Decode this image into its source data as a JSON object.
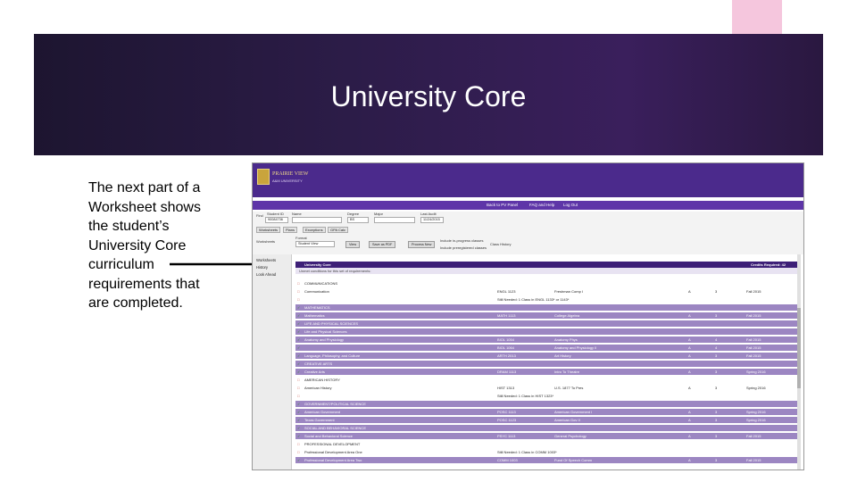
{
  "slide": {
    "title": "University Core",
    "body": "The next part of a Worksheet shows the student’s University Core curriculum requirements that are completed."
  },
  "colors": {
    "title_bg": "#2c1c48",
    "accent": "#f5c6dd",
    "header_purple": "#4b2a8c",
    "row_satisfied": "#9c86c2"
  },
  "screenshot": {
    "logo_name": "PRAIRIE VIEW",
    "logo_sub": "A&M UNIVERSITY",
    "nav": [
      "Back to PV Panel",
      "FAQ and Help",
      "Log Out"
    ],
    "form": {
      "student_id_label": "Student ID",
      "student_id_value": "90084736",
      "name_label": "Name",
      "degree_label": "Degree",
      "degree_value": "BS",
      "major_label": "Major",
      "last_audit_label": "Last Audit",
      "last_audit_value": "11/24/2015",
      "find_label": "Find",
      "format_label": "Format",
      "format_value": "Student View",
      "worksheets_label": "Worksheets",
      "tabs": [
        "Worksheets",
        "Plans",
        "Exceptions",
        "GPA Calc"
      ],
      "buttons": [
        "View",
        "Save as PDF",
        "Process New"
      ],
      "checkbox_1": "Include in-progress classes",
      "checkbox_2": "Include preregistered classes",
      "class_history": "Class History"
    },
    "sidebar": [
      "Worksheets",
      "History",
      "Look Ahead"
    ],
    "header_row": {
      "label": "University Core",
      "credits": "Credits Required: 42"
    },
    "note_row": "Unmet conditions for this set of requirements: ",
    "rows": [
      {
        "name": "COMMUNICATIONS",
        "status": "unsat",
        "course": "",
        "title": "",
        "grade": "",
        "credits": "",
        "term": ""
      },
      {
        "name": "Communication",
        "status": "unsat",
        "course": "ENGL 1123",
        "title": "Freshman Comp I",
        "grade": "A",
        "credits": "3",
        "term": "Fall 2015"
      },
      {
        "name": "",
        "status": "unsat",
        "course": "Still Needed: 1 Class in ENGL 1133* or 1143*",
        "title": "",
        "grade": "",
        "credits": "",
        "term": ""
      },
      {
        "name": "MATHEMATICS",
        "status": "sat",
        "course": "",
        "title": "",
        "grade": "",
        "credits": "",
        "term": ""
      },
      {
        "name": "Mathematics",
        "status": "sat",
        "course": "MATH 1113",
        "title": "College Algebra",
        "grade": "A",
        "credits": "3",
        "term": "Fall 2015"
      },
      {
        "name": "LIFE AND PHYSICAL SCIENCES",
        "status": "sat",
        "course": "",
        "title": "",
        "grade": "",
        "credits": "",
        "term": ""
      },
      {
        "name": "Life and Physical Sciences",
        "status": "sat",
        "course": "",
        "title": "",
        "grade": "",
        "credits": "",
        "term": ""
      },
      {
        "name": "Anatomy and Physiology",
        "status": "sat",
        "course": "BIOL 1054",
        "title": "Anatomy Phys",
        "grade": "A",
        "credits": "4",
        "term": "Fall 2015"
      },
      {
        "name": "",
        "status": "sat",
        "course": "BIOL 1064",
        "title": "Anatomy and Physiology II",
        "grade": "A",
        "credits": "4",
        "term": "Fall 2015"
      },
      {
        "name": "Language, Philosophy, and Culture",
        "status": "sat",
        "course": "ARTH 2013",
        "title": "Art History",
        "grade": "A",
        "credits": "3",
        "term": "Fall 2015"
      },
      {
        "name": "CREATIVE ARTS",
        "status": "sat",
        "course": "",
        "title": "",
        "grade": "",
        "credits": "",
        "term": ""
      },
      {
        "name": "Creative Arts",
        "status": "sat",
        "course": "DRAM 1113",
        "title": "Intro To Theatre",
        "grade": "A",
        "credits": "3",
        "term": "Spring 2016"
      },
      {
        "name": "AMERICAN HISTORY",
        "status": "unsat",
        "course": "",
        "title": "",
        "grade": "",
        "credits": "",
        "term": ""
      },
      {
        "name": "American History",
        "status": "unsat",
        "course": "HIST 1313",
        "title": "U.S. 1877 To Pres",
        "grade": "A",
        "credits": "3",
        "term": "Spring 2016"
      },
      {
        "name": "",
        "status": "unsat",
        "course": "Still Needed: 1 Class in HIST 1323*",
        "title": "",
        "grade": "",
        "credits": "",
        "term": ""
      },
      {
        "name": "GOVERNMENT/POLITICAL SCIENCE",
        "status": "sat",
        "course": "",
        "title": "",
        "grade": "",
        "credits": "",
        "term": ""
      },
      {
        "name": "American Government",
        "status": "sat",
        "course": "POSC 1113",
        "title": "American Government I",
        "grade": "A",
        "credits": "3",
        "term": "Spring 2016"
      },
      {
        "name": "Texas Government",
        "status": "sat",
        "course": "POSC 1123",
        "title": "American Gov II",
        "grade": "A",
        "credits": "3",
        "term": "Spring 2016"
      },
      {
        "name": "SOCIAL AND BEHAVIORAL SCIENCE",
        "status": "sat",
        "course": "",
        "title": "",
        "grade": "",
        "credits": "",
        "term": ""
      },
      {
        "name": "Social and Behavioral Science",
        "status": "sat",
        "course": "PSYC 1113",
        "title": "General Psychology",
        "grade": "A",
        "credits": "3",
        "term": "Fall 2015"
      },
      {
        "name": "PROFESSIONAL DEVELOPMENT",
        "status": "unsat",
        "course": "",
        "title": "",
        "grade": "",
        "credits": "",
        "term": ""
      },
      {
        "name": "Professional Development Area One",
        "status": "unsat",
        "course": "Still Needed: 1 Class in COMM 1003*",
        "title": "",
        "grade": "",
        "credits": "",
        "term": ""
      },
      {
        "name": "Professional Development Area Two",
        "status": "sat",
        "course": "COMM 1003",
        "title": "Fund Of Speech Comm",
        "grade": "A",
        "credits": "3",
        "term": "Fall 2015"
      }
    ]
  }
}
